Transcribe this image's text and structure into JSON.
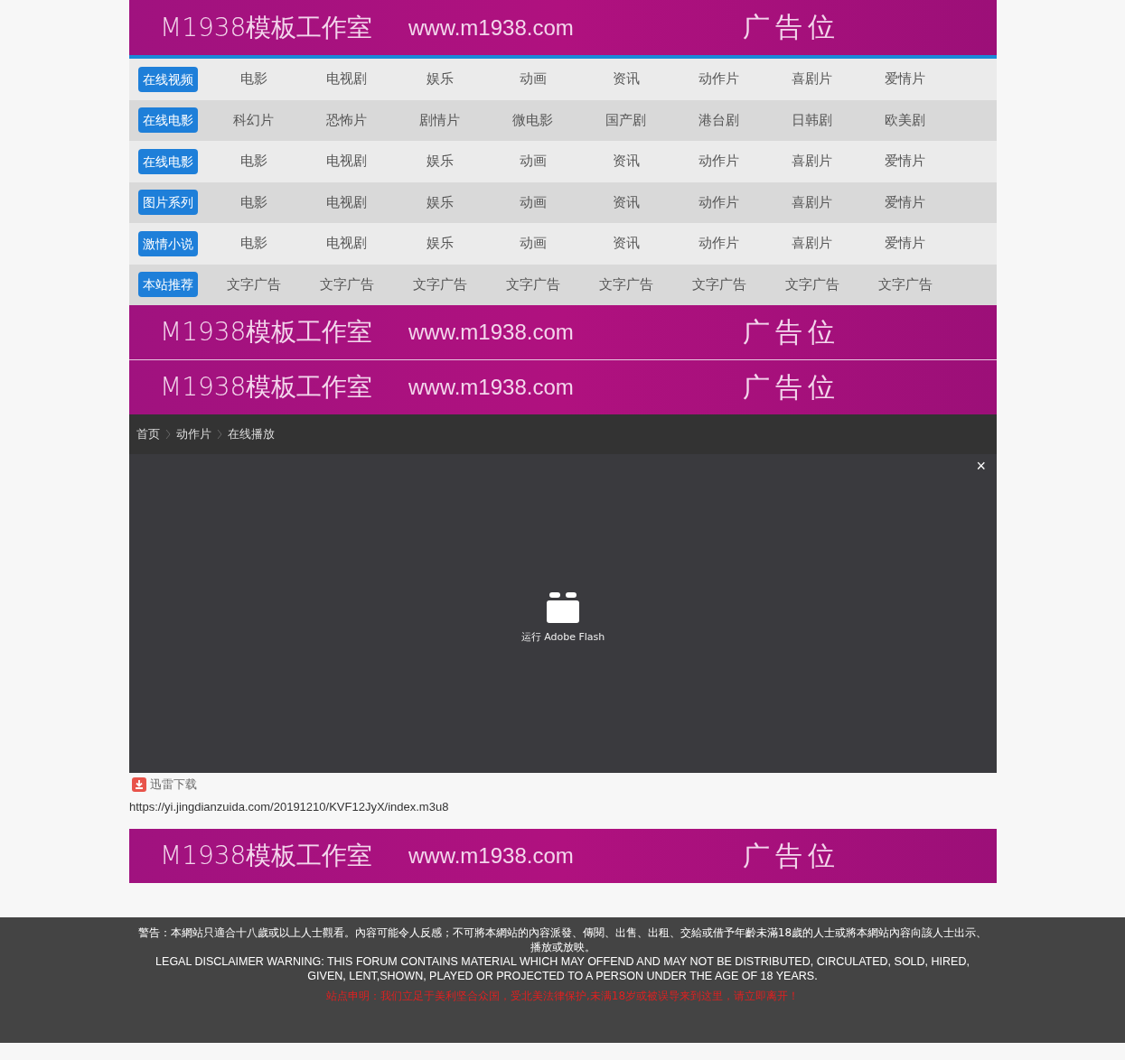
{
  "top_banner": {
    "brand": "M1938模板工作室",
    "url": "www.m1938.com",
    "ad": "广告位"
  },
  "nav_rows": [
    {
      "label": "在线视频",
      "items": [
        "电影",
        "电视剧",
        "娱乐",
        "动画",
        "资讯",
        "动作片",
        "喜剧片",
        "爱情片"
      ]
    },
    {
      "label": "在线电影",
      "items": [
        "科幻片",
        "恐怖片",
        "剧情片",
        "微电影",
        "国产剧",
        "港台剧",
        "日韩剧",
        "欧美剧"
      ]
    },
    {
      "label": "在线电影",
      "items": [
        "电影",
        "电视剧",
        "娱乐",
        "动画",
        "资讯",
        "动作片",
        "喜剧片",
        "爱情片"
      ]
    },
    {
      "label": "图片系列",
      "items": [
        "电影",
        "电视剧",
        "娱乐",
        "动画",
        "资讯",
        "动作片",
        "喜剧片",
        "爱情片"
      ]
    },
    {
      "label": "激情小说",
      "items": [
        "电影",
        "电视剧",
        "娱乐",
        "动画",
        "资讯",
        "动作片",
        "喜剧片",
        "爱情片"
      ]
    },
    {
      "label": "本站推荐",
      "items": [
        "文字广告",
        "文字广告",
        "文字广告",
        "文字广告",
        "文字广告",
        "文字广告",
        "文字广告",
        "文字广告"
      ]
    }
  ],
  "mid_banners": [
    {
      "brand": "M1938模板工作室",
      "url": "www.m1938.com",
      "ad": "广告位"
    },
    {
      "brand": "M1938模板工作室",
      "url": "www.m1938.com",
      "ad": "广告位"
    }
  ],
  "breadcrumb": [
    "首页",
    "动作片",
    "在线播放"
  ],
  "player": {
    "close": "×",
    "prompt": "运行 Adobe Flash"
  },
  "download": {
    "label": "迅雷下载",
    "url": "https://yi.jingdianzuida.com/20191210/KVF12JyX/index.m3u8"
  },
  "bottom_banner": {
    "brand": "M1938模板工作室",
    "url": "www.m1938.com",
    "ad": "广告位"
  },
  "footer": {
    "warning_zh": "警告：本網站只適合十八歲或以上人士觀看。內容可能令人反感；不可將本網站的內容派發、傳閱、出售、出租、交給或借予年齡未滿18歲的人士或將本網站內容向該人士出示、播放或放映。",
    "warning_en": "LEGAL DISCLAIMER WARNING: THIS FORUM CONTAINS MATERIAL WHICH MAY OFFEND AND MAY NOT BE DISTRIBUTED, CIRCULATED, SOLD, HIRED, GIVEN, LENT,SHOWN, PLAYED OR PROJECTED TO A PERSON UNDER THE AGE OF 18 YEARS.",
    "notice": "站点申明：我们立足于美利坚合众国，受北美法律保护,未满18岁或被误导来到这里，请立即离开！"
  }
}
